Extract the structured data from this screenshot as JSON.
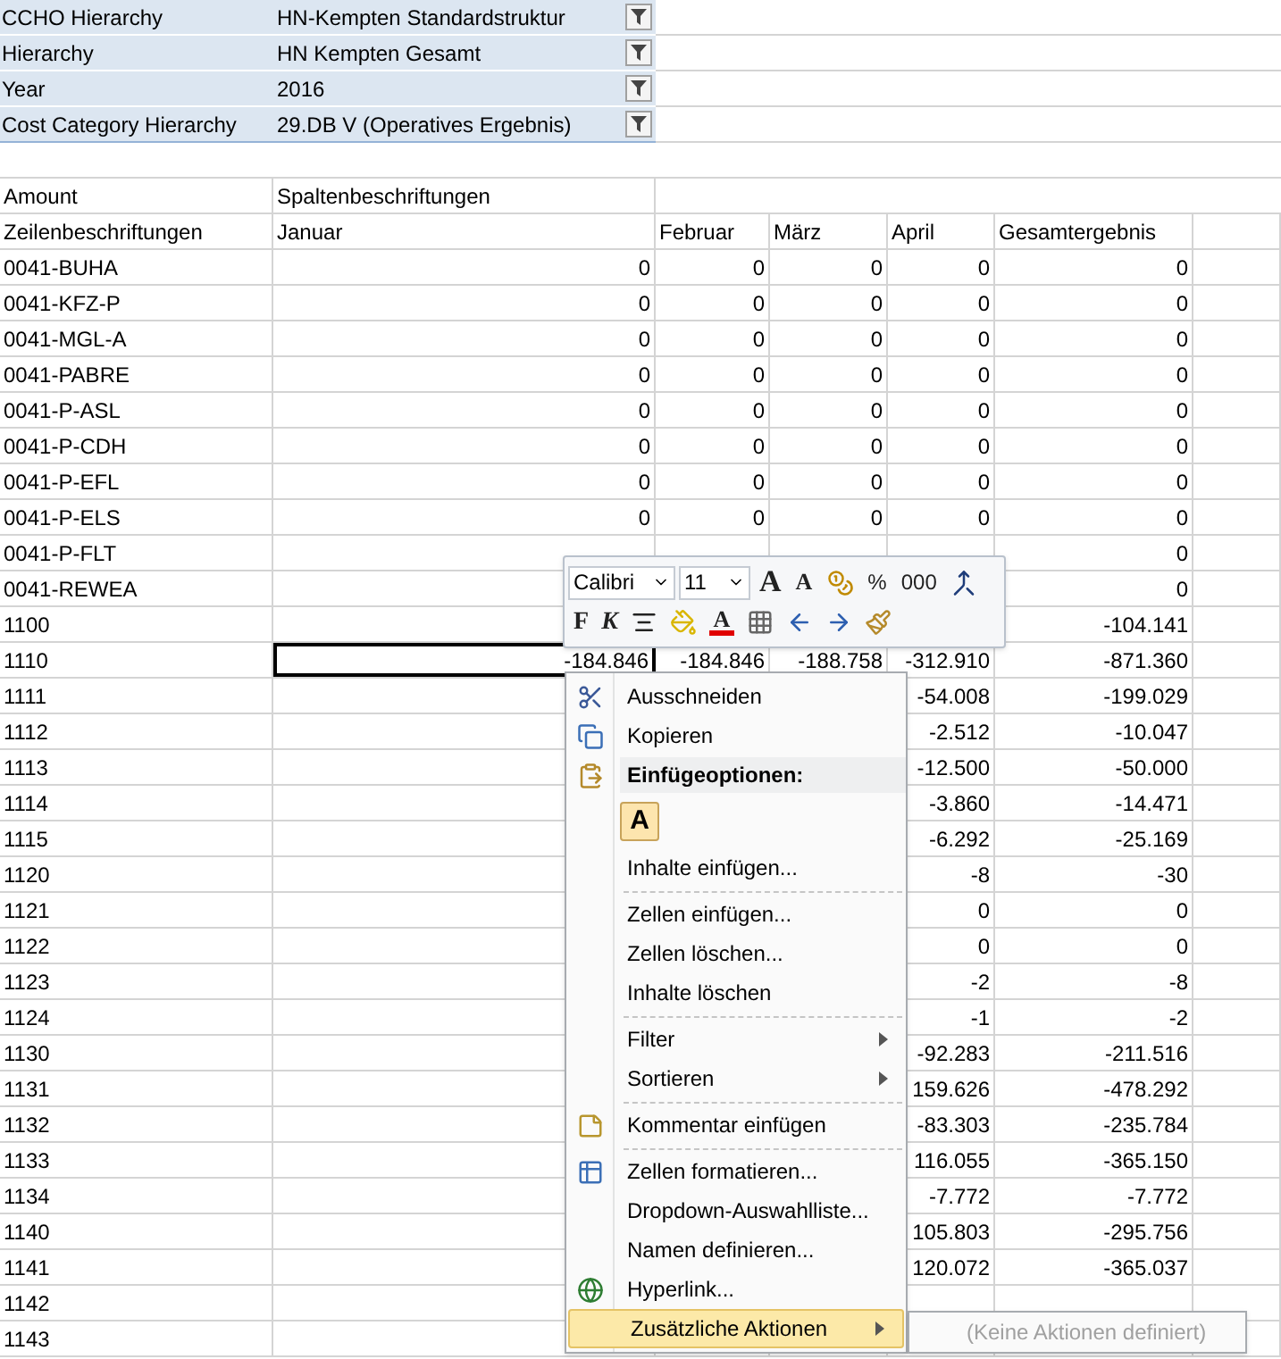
{
  "filters": [
    {
      "label": "CCHO Hierarchy",
      "value": "HN-Kempten Standardstruktur"
    },
    {
      "label": "Hierarchy",
      "value": "HN Kempten Gesamt"
    },
    {
      "label": "Year",
      "value": "2016"
    },
    {
      "label": "Cost Category Hierarchy",
      "value": "29.DB V (Operatives Ergebnis)"
    }
  ],
  "pivot": {
    "value_label": "Amount",
    "column_labels": "Spaltenbeschriftungen",
    "row_labels": "Zeilenbeschriftungen",
    "columns": [
      "Januar",
      "Februar",
      "März",
      "April",
      "Gesamtergebnis"
    ],
    "rows": [
      {
        "label": "0041-BUHA",
        "selected": false,
        "cells": [
          "0",
          "0",
          "0",
          "0",
          "0"
        ]
      },
      {
        "label": "0041-KFZ-P",
        "selected": false,
        "cells": [
          "0",
          "0",
          "0",
          "0",
          "0"
        ]
      },
      {
        "label": "0041-MGL-A",
        "selected": false,
        "cells": [
          "0",
          "0",
          "0",
          "0",
          "0"
        ]
      },
      {
        "label": "0041-PABRE",
        "selected": false,
        "cells": [
          "0",
          "0",
          "0",
          "0",
          "0"
        ]
      },
      {
        "label": "0041-P-ASL",
        "selected": false,
        "cells": [
          "0",
          "0",
          "0",
          "0",
          "0"
        ]
      },
      {
        "label": "0041-P-CDH",
        "selected": false,
        "cells": [
          "0",
          "0",
          "0",
          "0",
          "0"
        ]
      },
      {
        "label": "0041-P-EFL",
        "selected": false,
        "cells": [
          "0",
          "0",
          "0",
          "0",
          "0"
        ]
      },
      {
        "label": "0041-P-ELS",
        "selected": false,
        "cells": [
          "0",
          "0",
          "0",
          "0",
          "0"
        ]
      },
      {
        "label": "0041-P-FLT",
        "selected": false,
        "cells": [
          null,
          null,
          null,
          null,
          "0"
        ]
      },
      {
        "label": "0041-REWEA",
        "selected": false,
        "cells": [
          null,
          null,
          null,
          null,
          "0"
        ]
      },
      {
        "label": "1100",
        "selected": false,
        "cells": [
          null,
          null,
          null,
          null,
          "-104.141"
        ]
      },
      {
        "label": "1110",
        "selected": true,
        "cells": [
          "-184.846",
          "-184.846",
          "-188.758",
          "-312.910",
          "-871.360"
        ]
      },
      {
        "label": "1111",
        "selected": false,
        "cells": [
          null,
          null,
          null,
          "-54.008",
          "-199.029"
        ]
      },
      {
        "label": "1112",
        "selected": false,
        "cells": [
          null,
          null,
          null,
          "-2.512",
          "-10.047"
        ]
      },
      {
        "label": "1113",
        "selected": false,
        "cells": [
          null,
          null,
          null,
          "-12.500",
          "-50.000"
        ]
      },
      {
        "label": "1114",
        "selected": false,
        "cells": [
          null,
          null,
          null,
          "-3.860",
          "-14.471"
        ]
      },
      {
        "label": "1115",
        "selected": false,
        "cells": [
          null,
          null,
          null,
          "-6.292",
          "-25.169"
        ]
      },
      {
        "label": "1120",
        "selected": false,
        "cells": [
          null,
          null,
          null,
          "-8",
          "-30"
        ]
      },
      {
        "label": "1121",
        "selected": false,
        "cells": [
          null,
          null,
          null,
          "0",
          "0"
        ]
      },
      {
        "label": "1122",
        "selected": false,
        "cells": [
          null,
          null,
          null,
          "0",
          "0"
        ]
      },
      {
        "label": "1123",
        "selected": false,
        "cells": [
          null,
          null,
          null,
          "-2",
          "-8"
        ]
      },
      {
        "label": "1124",
        "selected": false,
        "cells": [
          null,
          null,
          null,
          "-1",
          "-2"
        ]
      },
      {
        "label": "1130",
        "selected": false,
        "cells": [
          null,
          null,
          null,
          "-92.283",
          "-211.516"
        ]
      },
      {
        "label": "1131",
        "selected": false,
        "cells": [
          null,
          null,
          null,
          "159.626",
          "-478.292"
        ]
      },
      {
        "label": "1132",
        "selected": false,
        "cells": [
          null,
          null,
          null,
          "-83.303",
          "-235.784"
        ]
      },
      {
        "label": "1133",
        "selected": false,
        "cells": [
          null,
          null,
          null,
          "116.055",
          "-365.150"
        ]
      },
      {
        "label": "1134",
        "selected": false,
        "cells": [
          null,
          null,
          null,
          "-7.772",
          "-7.772"
        ]
      },
      {
        "label": "1140",
        "selected": false,
        "cells": [
          null,
          null,
          null,
          "105.803",
          "-295.756"
        ]
      },
      {
        "label": "1141",
        "selected": false,
        "cells": [
          null,
          null,
          null,
          "120.072",
          "-365.037"
        ]
      },
      {
        "label": "1142",
        "selected": false,
        "cells": [
          null,
          null,
          null,
          null,
          null
        ]
      },
      {
        "label": "1143",
        "selected": false,
        "cells": [
          null,
          null,
          null,
          null,
          null
        ]
      }
    ]
  },
  "mini_toolbar": {
    "font": "Calibri",
    "size": "11",
    "row1": [
      {
        "kind": "grow",
        "label": "A"
      },
      {
        "kind": "shrink",
        "label": "A"
      },
      {
        "kind": "accounting"
      },
      {
        "kind": "text",
        "label": "%"
      },
      {
        "kind": "text",
        "label": "000"
      },
      {
        "kind": "merge"
      }
    ],
    "row2": [
      {
        "kind": "bold",
        "label": "F"
      },
      {
        "kind": "italic",
        "label": "K"
      },
      {
        "kind": "align"
      },
      {
        "kind": "fill"
      },
      {
        "kind": "fontcolor",
        "label": "A"
      },
      {
        "kind": "borders"
      },
      {
        "kind": "inc_decimal"
      },
      {
        "kind": "dec_decimal"
      },
      {
        "kind": "brush"
      }
    ]
  },
  "context_menu": [
    {
      "kind": "item",
      "label": "Ausschneiden",
      "submenu": false,
      "highlighted": false
    },
    {
      "kind": "item",
      "label": "Kopieren",
      "submenu": false,
      "highlighted": false
    },
    {
      "kind": "header",
      "label": "Einfügeoptionen:"
    },
    {
      "kind": "paste_options",
      "options": [
        "A"
      ]
    },
    {
      "kind": "item",
      "label": "Inhalte einfügen...",
      "submenu": false,
      "highlighted": false
    },
    {
      "kind": "separator"
    },
    {
      "kind": "item",
      "label": "Zellen einfügen...",
      "submenu": false,
      "highlighted": false
    },
    {
      "kind": "item",
      "label": "Zellen löschen...",
      "submenu": false,
      "highlighted": false
    },
    {
      "kind": "item",
      "label": "Inhalte löschen",
      "submenu": false,
      "highlighted": false
    },
    {
      "kind": "separator"
    },
    {
      "kind": "item",
      "label": "Filter",
      "submenu": true,
      "highlighted": false
    },
    {
      "kind": "item",
      "label": "Sortieren",
      "submenu": true,
      "highlighted": false
    },
    {
      "kind": "separator"
    },
    {
      "kind": "item",
      "label": "Kommentar einfügen",
      "submenu": false,
      "highlighted": false
    },
    {
      "kind": "separator"
    },
    {
      "kind": "item",
      "label": "Zellen formatieren...",
      "submenu": false,
      "highlighted": false
    },
    {
      "kind": "item",
      "label": "Dropdown-Auswahlliste...",
      "submenu": false,
      "highlighted": false
    },
    {
      "kind": "item",
      "label": "Namen definieren...",
      "submenu": false,
      "highlighted": false
    },
    {
      "kind": "item",
      "label": "Hyperlink...",
      "submenu": false,
      "highlighted": false
    },
    {
      "kind": "item",
      "label": "Zusätzliche Aktionen",
      "submenu": true,
      "highlighted": true
    }
  ],
  "submenu": {
    "label": "(Keine Aktionen definiert)",
    "disabled": true
  }
}
